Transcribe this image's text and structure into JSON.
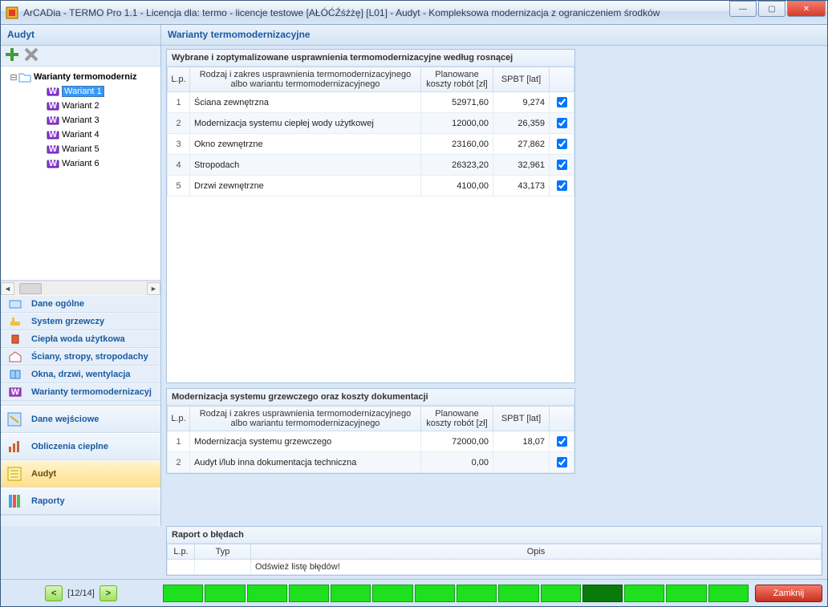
{
  "window": {
    "title": "ArCADia - TERMO Pro 1.1 - Licencja dla: termo - licencje testowe [AŁÓĆŹśźżę] [L01] - Audyt - Kompleksowa modernizacja z ograniczeniem środków"
  },
  "header": {
    "left": "Audyt",
    "right": "Warianty termomodernizacyjne"
  },
  "tree": {
    "root": "Warianty termomoderniz",
    "items": [
      "Wariant 1",
      "Wariant 2",
      "Wariant 3",
      "Wariant 4",
      "Wariant 5",
      "Wariant 6"
    ],
    "selected_index": 0
  },
  "nav": {
    "items": [
      "Dane ogólne",
      "System grzewczy",
      "Ciepła woda użytkowa",
      "Ściany, stropy, stropodachy",
      "Okna, drzwi, wentylacja",
      "Warianty termomodernizacyj"
    ],
    "big": [
      "Dane wejściowe",
      "Obliczenia cieplne",
      "Audyt",
      "Raporty"
    ],
    "big_active_index": 2
  },
  "panel_a": {
    "title": "Wybrane i zoptymalizowane usprawnienia termomodernizacyjne według rosnącej",
    "cols": [
      "L.p.",
      "Rodzaj i zakres usprawnienia termomodernizacyjnego albo wariantu termomodernizacyjnego",
      "Planowane koszty robót [zł]",
      "SPBT [lat]",
      ""
    ],
    "rows": [
      {
        "lp": "1",
        "name": "Ściana zewnętrzna",
        "cost": "52971,60",
        "spbt": "9,274",
        "chk": true
      },
      {
        "lp": "2",
        "name": "Modernizacja systemu ciepłej wody użytkowej",
        "cost": "12000,00",
        "spbt": "26,359",
        "chk": true
      },
      {
        "lp": "3",
        "name": "Okno zewnętrzne",
        "cost": "23160,00",
        "spbt": "27,862",
        "chk": true
      },
      {
        "lp": "4",
        "name": "Stropodach",
        "cost": "26323,20",
        "spbt": "32,961",
        "chk": true
      },
      {
        "lp": "5",
        "name": "Drzwi zewnętrzne",
        "cost": "4100,00",
        "spbt": "43,173",
        "chk": true
      }
    ]
  },
  "panel_b": {
    "title": "Modernizacja systemu grzewczego oraz koszty dokumentacji",
    "cols": [
      "L.p.",
      "Rodzaj i zakres usprawnienia termomodernizacyjnego albo wariantu termomodernizacyjnego",
      "Planowane koszty robót [zł]",
      "SPBT [lat]",
      ""
    ],
    "rows": [
      {
        "lp": "1",
        "name": "Modernizacja systemu grzewczego",
        "cost": "72000,00",
        "spbt": "18,07",
        "chk": true,
        "link": false
      },
      {
        "lp": "2",
        "name": "Audyt i/lub inna dokumentacja techniczna",
        "cost": "0,00",
        "spbt": "",
        "chk": true,
        "link": true
      }
    ]
  },
  "panel_err": {
    "title": "Raport o błędach",
    "cols": [
      "L.p.",
      "Typ",
      "Opis"
    ],
    "message": "Odśwież listę błędów!"
  },
  "footer": {
    "pager": "[12/14]",
    "close": "Zamknij",
    "segments": 14,
    "dark_index": 10
  }
}
